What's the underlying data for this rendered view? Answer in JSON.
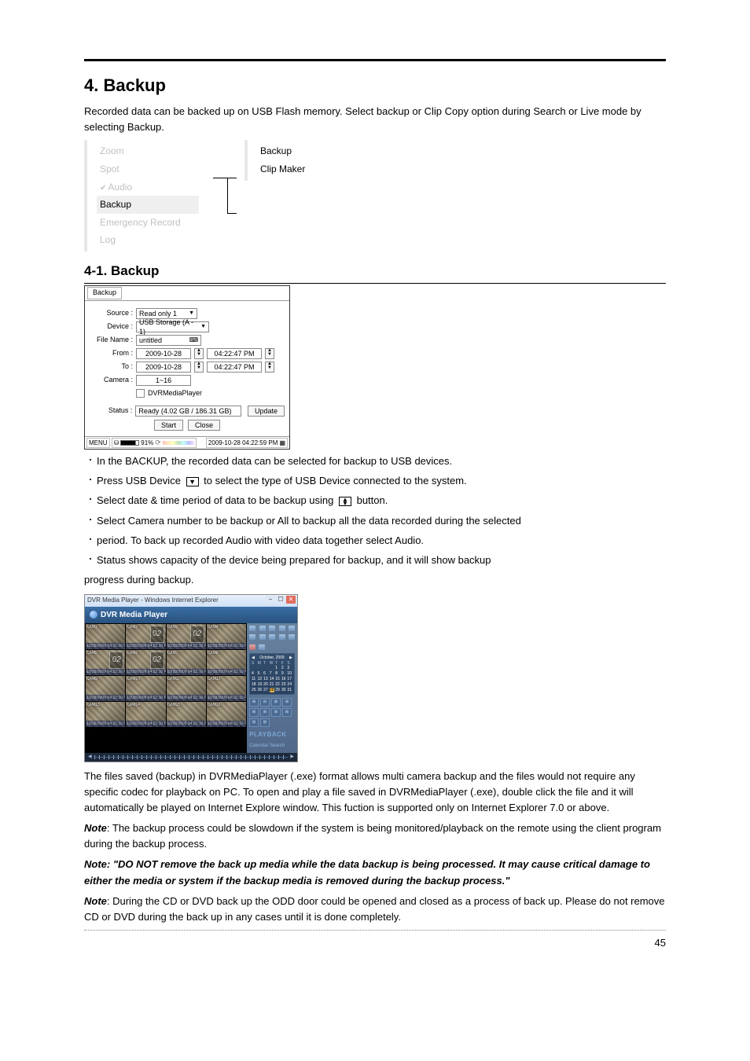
{
  "heading": "4. Backup",
  "intro": "Recorded data can be backed up on USB Flash memory. Select backup or Clip Copy option during Search or Live mode by selecting Backup.",
  "menu": {
    "main": [
      "Zoom",
      "Spot",
      "Audio",
      "Backup",
      "Emergency Record",
      "Log"
    ],
    "main_active_index": 3,
    "sub": [
      "Backup",
      "Clip Maker"
    ]
  },
  "subheading": "4-1. Backup",
  "dialog": {
    "title": "Backup",
    "rows": {
      "source_label": "Source :",
      "source_value": "Read only 1",
      "device_label": "Device :",
      "device_value": "USB Storage (A - 1)",
      "filename_label": "File Name :",
      "filename_value": "untitled",
      "from_label": "From :",
      "from_date": "2009-10-28",
      "from_time": "04:22:47 PM",
      "to_label": "To :",
      "to_date": "2009-10-28",
      "to_time": "04:22:47 PM",
      "camera_label": "Camera :",
      "camera_value": "1~16",
      "dvrmp_checkbox": "DVRMediaPlayer",
      "status_label": "Status :",
      "status_value": "Ready  (4.02 GB / 186.31 GB)",
      "update": "Update",
      "start": "Start",
      "close": "Close"
    },
    "statusbar": {
      "menu": "MENU",
      "pct": "91%",
      "clock": "2009-10-28 04:22:59 PM"
    }
  },
  "bullets": [
    "In the BACKUP, the recorded data can be selected for backup to USB devices.",
    "Press USB Device [drop] to select the type of USB Device connected to the system.",
    "Select date & time period of data to be backup using [spin] button.",
    "Select Camera number to be backup or All to backup all the data recorded during the selected",
    "period. To back up recorded Audio with video data together select Audio.",
    "Status shows capacity of the device being prepared for backup, and it will show backup"
  ],
  "bullet_tail": "progress during backup.",
  "player": {
    "window_title": "DVR Media Player - Windows Internet Explorer",
    "app_title": "DVR Media Player",
    "cameras": [
      "CAM1",
      "CAM2",
      "CAM3",
      "CAM4",
      "CAM5",
      "CAM6",
      "CAM7",
      "CAM8",
      "CAM9",
      "CAM10",
      "CAM11",
      "CAM12",
      "CAM13",
      "CAM14",
      "CAM15",
      "CAM16"
    ],
    "caption_sample": "10/28/2009 04:22:10 PM",
    "clock_num": "02",
    "calendar": {
      "month": "October, 2009",
      "dow": [
        "S",
        "M",
        "T",
        "W",
        "T",
        "F",
        "S"
      ],
      "selected": 28
    },
    "playback_label": "PLAYBACK",
    "playback_sub": "Calendar Search"
  },
  "para_after_player": "The files saved (backup) in DVRMediaPlayer (.exe) format allows multi camera backup and the files would not require any specific codec for playback on PC. To open and play a file saved in DVRMediaPlayer (.exe), double click the file and it will automatically be played on Internet Explore window. This fuction is supported only on Internet Explorer 7.0 or above.",
  "note1_label": "Note",
  "note1_text": ": The backup process could be slowdown if the system is being monitored/playback on the remote using the client program during the backup process.",
  "note2": "Note: \"DO NOT remove the back up media while the data backup is being processed. It may cause critical damage to either the media or system if the backup media is removed during the backup process.\"",
  "note3_label": "Note",
  "note3_text": ": During the CD or DVD back up the ODD door could be opened and closed as a process of back up. Please do not remove CD or DVD during the back up in any cases until it is done completely.",
  "page_number": "45"
}
